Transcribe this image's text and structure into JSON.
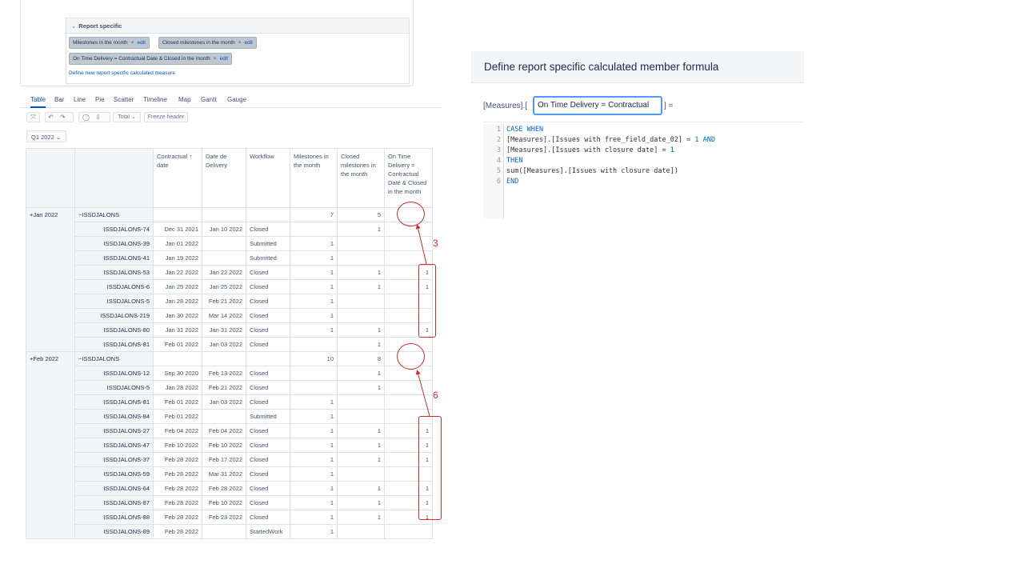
{
  "report_specific": {
    "title": "Report specific",
    "measures": [
      {
        "label": "Milestones in the month",
        "edit": "edit"
      },
      {
        "label": "Closed milestones in the month",
        "edit": "edit"
      },
      {
        "label": "On Time Delivery = Contractual Date & Closed in the month",
        "edit": "edit"
      }
    ],
    "define_link": "Define new report specific calculated measure"
  },
  "chart_tabs": [
    "Table",
    "Bar",
    "Line",
    "Pie",
    "Scatter",
    "Timeline",
    "Map",
    "Gantt",
    "Gauge"
  ],
  "toolbar": {
    "total_label": "Total",
    "freeze_label": "Freeze header"
  },
  "period": "Q1 2022",
  "table": {
    "columns": [
      "Contractual ↑ date",
      "Date de Delivery",
      "Workflow",
      "Milestones in the month",
      "Closed milestones in the month",
      "On Time Delivery = Contractual Date & Closed in the month"
    ],
    "groups": [
      {
        "month": "Jan 2022",
        "group": "ISSDJALONS",
        "milestones": "7",
        "closed": "5",
        "rows": [
          {
            "id": "ISSDJALONS-74",
            "contractual": "Dec 31 2021",
            "delivery": "Jan 10 2022",
            "workflow": "Closed",
            "milestones": "",
            "closed": "1",
            "ontime": ""
          },
          {
            "id": "ISSDJALONS-39",
            "contractual": "Jan 01 2022",
            "delivery": "",
            "workflow": "Submitted",
            "milestones": "1",
            "closed": "",
            "ontime": ""
          },
          {
            "id": "ISSDJALONS-41",
            "contractual": "Jan 19 2022",
            "delivery": "",
            "workflow": "Submitted",
            "milestones": "1",
            "closed": "",
            "ontime": ""
          },
          {
            "id": "ISSDJALONS-53",
            "contractual": "Jan 22 2022",
            "delivery": "Jan 22 2022",
            "workflow": "Closed",
            "milestones": "1",
            "closed": "1",
            "ontime": "1"
          },
          {
            "id": "ISSDJALONS-6",
            "contractual": "Jan 25 2022",
            "delivery": "Jan 25 2022",
            "workflow": "Closed",
            "milestones": "1",
            "closed": "1",
            "ontime": "1"
          },
          {
            "id": "ISSDJALONS-5",
            "contractual": "Jan 28 2022",
            "delivery": "Feb 21 2022",
            "workflow": "Closed",
            "milestones": "1",
            "closed": "",
            "ontime": ""
          },
          {
            "id": "ISSDJALONS-219",
            "contractual": "Jan 30 2022",
            "delivery": "Mar 14 2022",
            "workflow": "Closed",
            "milestones": "1",
            "closed": "",
            "ontime": ""
          },
          {
            "id": "ISSDJALONS-80",
            "contractual": "Jan 31 2022",
            "delivery": "Jan 31 2022",
            "workflow": "Closed",
            "milestones": "1",
            "closed": "1",
            "ontime": "1"
          },
          {
            "id": "ISSDJALONS-81",
            "contractual": "Feb 01 2022",
            "delivery": "Jan 03 2022",
            "workflow": "Closed",
            "milestones": "",
            "closed": "1",
            "ontime": ""
          }
        ]
      },
      {
        "month": "Feb 2022",
        "group": "ISSDJALONS",
        "milestones": "10",
        "closed": "8",
        "rows": [
          {
            "id": "ISSDJALONS-12",
            "contractual": "Sep 30 2020",
            "delivery": "Feb 13 2022",
            "workflow": "Closed",
            "milestones": "",
            "closed": "1",
            "ontime": ""
          },
          {
            "id": "ISSDJALONS-5",
            "contractual": "Jan 28 2022",
            "delivery": "Feb 21 2022",
            "workflow": "Closed",
            "milestones": "",
            "closed": "1",
            "ontime": ""
          },
          {
            "id": "ISSDJALONS-81",
            "contractual": "Feb 01 2022",
            "delivery": "Jan 03 2022",
            "workflow": "Closed",
            "milestones": "1",
            "closed": "",
            "ontime": ""
          },
          {
            "id": "ISSDJALONS-84",
            "contractual": "Feb 01 2022",
            "delivery": "",
            "workflow": "Submitted",
            "milestones": "1",
            "closed": "",
            "ontime": ""
          },
          {
            "id": "ISSDJALONS-27",
            "contractual": "Feb 04 2022",
            "delivery": "Feb 04 2022",
            "workflow": "Closed",
            "milestones": "1",
            "closed": "1",
            "ontime": "1"
          },
          {
            "id": "ISSDJALONS-47",
            "contractual": "Feb 10 2022",
            "delivery": "Feb 10 2022",
            "workflow": "Closed",
            "milestones": "1",
            "closed": "1",
            "ontime": "1"
          },
          {
            "id": "ISSDJALONS-37",
            "contractual": "Feb 28 2022",
            "delivery": "Feb 17 2022",
            "workflow": "Closed",
            "milestones": "1",
            "closed": "1",
            "ontime": "1"
          },
          {
            "id": "ISSDJALONS-59",
            "contractual": "Feb 28 2022",
            "delivery": "Mar 31 2022",
            "workflow": "Closed",
            "milestones": "1",
            "closed": "",
            "ontime": ""
          },
          {
            "id": "ISSDJALONS-64",
            "contractual": "Feb 28 2022",
            "delivery": "Feb 28 2022",
            "workflow": "Closed",
            "milestones": "1",
            "closed": "1",
            "ontime": "1"
          },
          {
            "id": "ISSDJALONS-87",
            "contractual": "Feb 28 2022",
            "delivery": "Feb 10 2022",
            "workflow": "Closed",
            "milestones": "1",
            "closed": "1",
            "ontime": "1"
          },
          {
            "id": "ISSDJALONS-88",
            "contractual": "Feb 28 2022",
            "delivery": "Feb 23 2022",
            "workflow": "Closed",
            "milestones": "1",
            "closed": "1",
            "ontime": "1"
          },
          {
            "id": "ISSDJALONS-89",
            "contractual": "Feb 28 2022",
            "delivery": "",
            "workflow": "StartedWork",
            "milestones": "1",
            "closed": "",
            "ontime": ""
          }
        ]
      }
    ]
  },
  "annotations": {
    "jan_count": "3",
    "feb_count": "6",
    "color": "#d62828"
  },
  "formula": {
    "title": "Define report specific calculated member formula",
    "prefix": "[Measures].[",
    "name": "On Time Delivery = Contractual",
    "suffix": "] =",
    "lines": [
      [
        {
          "t": "CASE WHEN",
          "c": "kw"
        }
      ],
      [
        {
          "t": "[Measures].[Issues with free_field_date_02] = ",
          "c": ""
        },
        {
          "t": "1",
          "c": "n"
        },
        {
          "t": " AND",
          "c": "kw"
        }
      ],
      [
        {
          "t": "[Measures].[Issues with closure date] = ",
          "c": ""
        },
        {
          "t": "1",
          "c": "n"
        }
      ],
      [
        {
          "t": "THEN",
          "c": "kw"
        }
      ],
      [
        {
          "t": "sum([Measures].[Issues with closure date])",
          "c": ""
        }
      ],
      [
        {
          "t": "END",
          "c": "kw"
        }
      ]
    ],
    "line_numbers": [
      "1",
      "2",
      "3",
      "4",
      "5",
      "6"
    ]
  }
}
